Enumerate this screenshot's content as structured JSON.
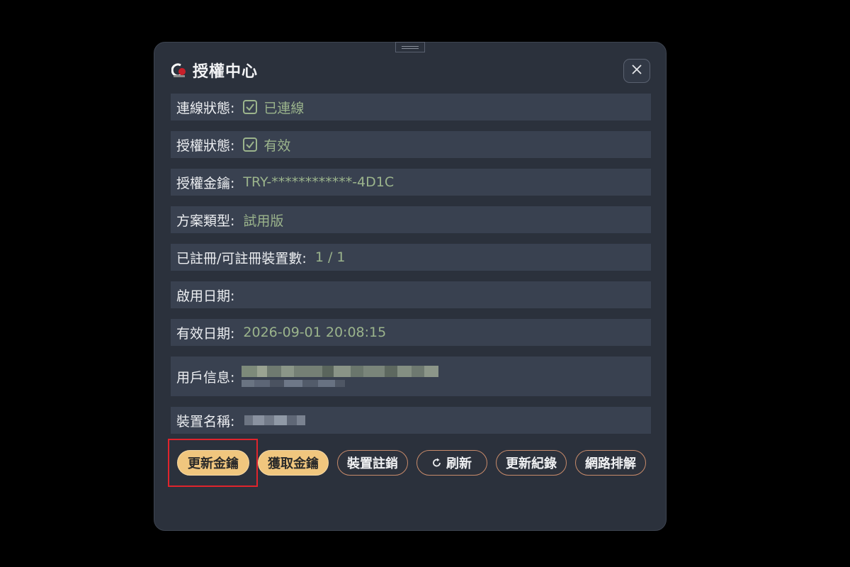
{
  "dialog": {
    "title": "授權中心",
    "close_icon": "close-icon",
    "app_icon": "app-logo-icon"
  },
  "rows": {
    "connection": {
      "label": "連線狀態:",
      "value": "已連線",
      "icon": "checkbox-checked-icon"
    },
    "license_status": {
      "label": "授權狀態:",
      "value": "有效",
      "icon": "checkbox-checked-icon"
    },
    "license_key": {
      "label": "授權金鑰:",
      "value": "TRY-************-4D1C"
    },
    "plan_type": {
      "label": "方案類型:",
      "value": "試用版"
    },
    "devices": {
      "label": "已註冊/可註冊裝置數:",
      "value": "1 / 1"
    },
    "activation_date": {
      "label": "啟用日期:",
      "value": ""
    },
    "expiry_date": {
      "label": "有效日期:",
      "value": "2026-09-01 20:08:15"
    },
    "user_info": {
      "label": "用戶信息:"
    },
    "device_name": {
      "label": "裝置名稱:"
    }
  },
  "buttons": {
    "update_key": "更新金鑰",
    "get_key": "獲取金鑰",
    "deregister": "裝置註銷",
    "refresh": "刷新",
    "refresh_icon": "refresh-icon",
    "update_log": "更新紀錄",
    "network_troubleshoot": "網路排解"
  },
  "colors": {
    "background": "#000000",
    "dialog": "#2b313c",
    "row": "#394150",
    "value_text": "#9bb48c",
    "primary_button": "#f0c67e",
    "highlight": "#e0242c"
  }
}
